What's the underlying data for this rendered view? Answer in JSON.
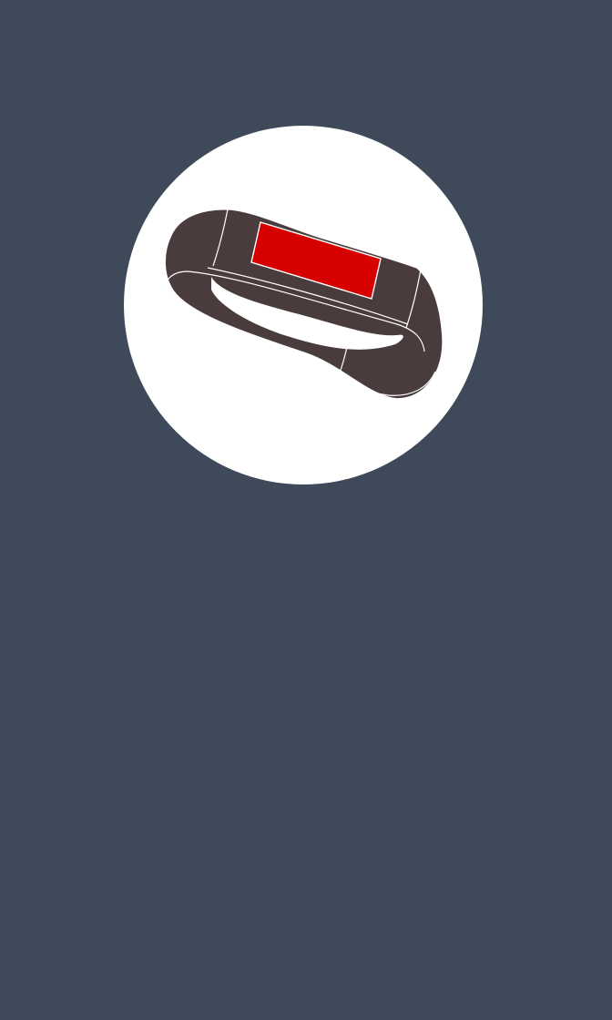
{
  "colors": {
    "background": "#3e4a59",
    "badge": "#ffffff",
    "band": "#4a3b3c",
    "band_outline": "#ffffff",
    "display": "#d60000"
  },
  "illustration": {
    "icon": "fitness-band-icon"
  }
}
